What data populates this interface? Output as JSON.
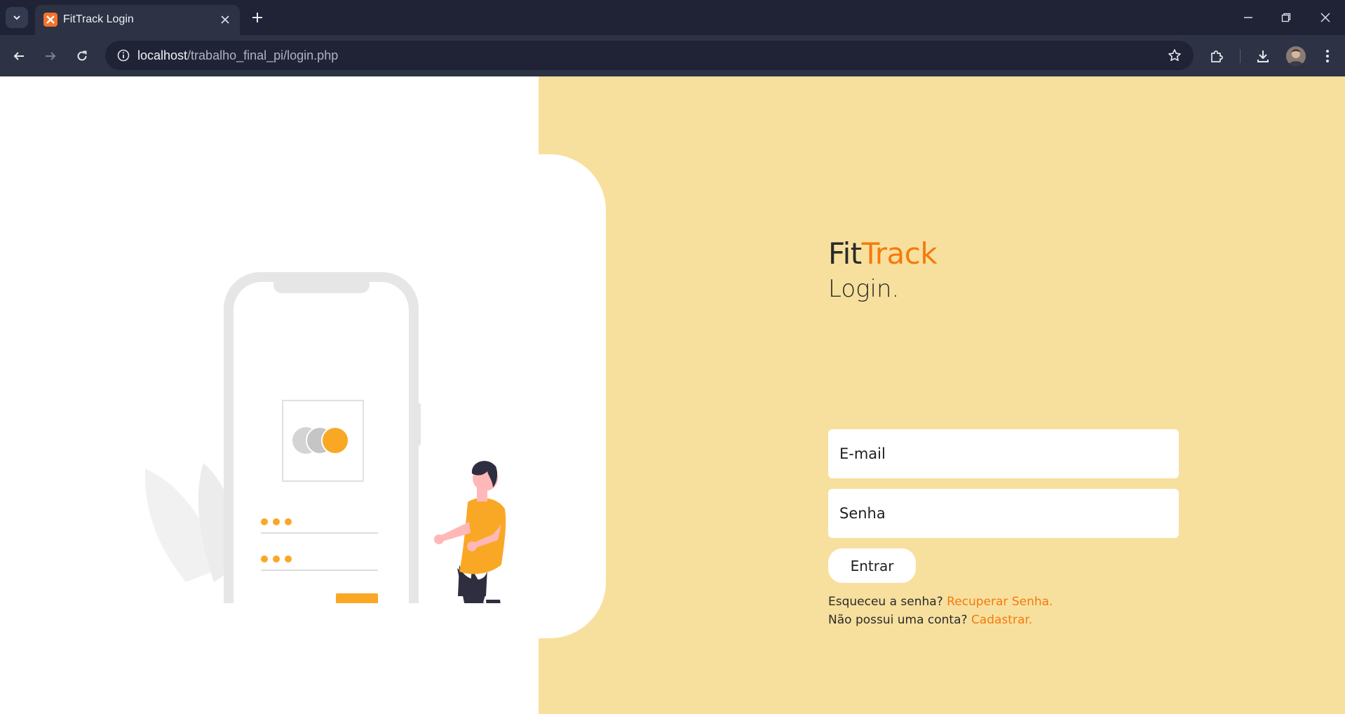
{
  "browser": {
    "tab": {
      "title": "FitTrack Login",
      "favicon": "xampp-icon"
    },
    "url": {
      "host": "localhost",
      "path": "/trabalho_final_pi/login.php"
    }
  },
  "colors": {
    "accent": "#f57a0c",
    "panel": "#f7e09e",
    "illustration_accent": "#f9a826"
  },
  "page": {
    "brand": {
      "part1": "Fit",
      "part2": "Track"
    },
    "subtitle": "Login.",
    "form": {
      "email_placeholder": "E-mail",
      "password_placeholder": "Senha",
      "submit_label": "Entrar"
    },
    "help": {
      "forgot_text": "Esqueceu a senha?",
      "forgot_link": "Recuperar Senha.",
      "noaccount_text": "Não possui uma conta?",
      "register_link": "Cadastrar."
    }
  }
}
